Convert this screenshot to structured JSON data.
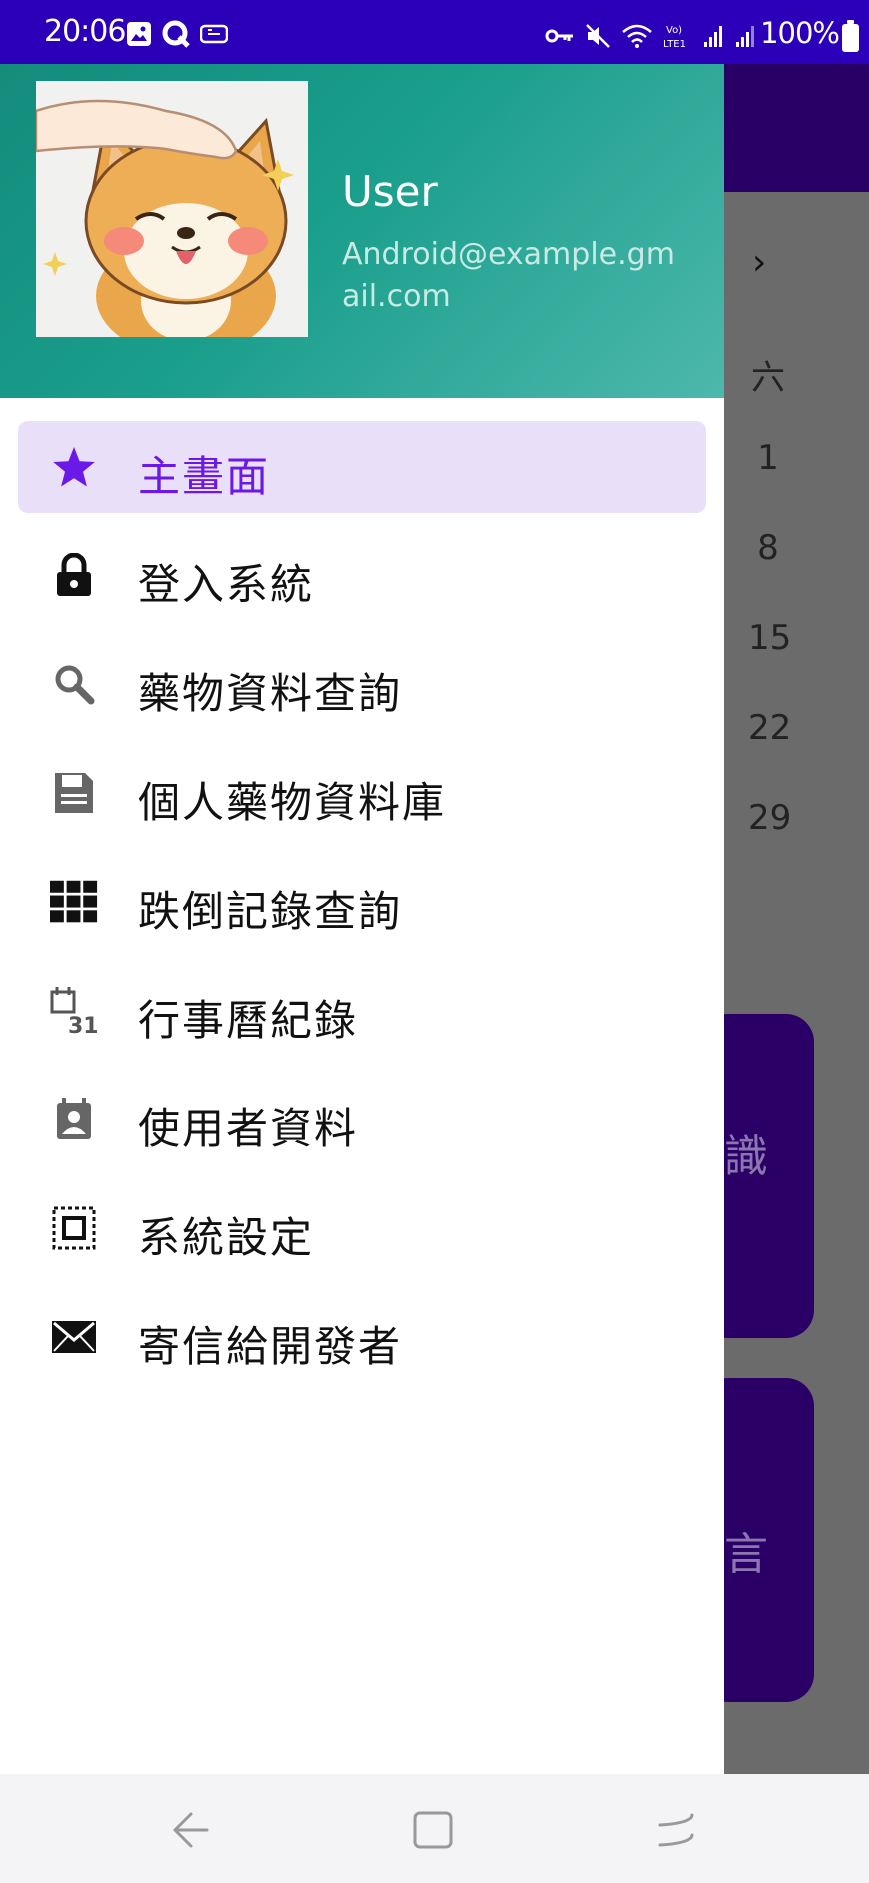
{
  "status_bar": {
    "time": "20:06",
    "battery": "100%",
    "left_icons": [
      "image-icon",
      "q-app-icon",
      "ticket-icon"
    ],
    "right_icons": [
      "key-icon",
      "mute-icon",
      "wifi-icon",
      "volte-icon",
      "signal-icon",
      "signal-icon-2"
    ]
  },
  "drawer": {
    "user_name": "User",
    "user_email": "Android@example.gmail.com",
    "menu": [
      {
        "label": "主畫面",
        "icon": "star-icon",
        "active": true
      },
      {
        "label": "登入系統",
        "icon": "lock-icon",
        "active": false
      },
      {
        "label": "藥物資料查詢",
        "icon": "search-icon",
        "active": false
      },
      {
        "label": "個人藥物資料庫",
        "icon": "save-icon",
        "active": false
      },
      {
        "label": "跌倒記錄查詢",
        "icon": "grid-icon",
        "active": false
      },
      {
        "label": "行事曆紀錄",
        "icon": "calendar-31-icon",
        "active": false
      },
      {
        "label": "使用者資料",
        "icon": "contact-icon",
        "active": false
      },
      {
        "label": "系統設定",
        "icon": "settings-frame-icon",
        "active": false
      },
      {
        "label": "寄信給開發者",
        "icon": "mail-icon",
        "active": false
      }
    ],
    "colors": {
      "accent": "#6a19e6",
      "active_bg": "#eadff8",
      "header_start": "#138c7c",
      "header_end": "#4db8ac"
    }
  },
  "background_app": {
    "chevron": "›",
    "weekday": "六",
    "dates": [
      "1",
      "8",
      "15",
      "22",
      "29"
    ],
    "card_1_fragment": "識",
    "card_2_fragment": "言"
  },
  "nav_bar": {
    "buttons": [
      "back-icon",
      "home-icon",
      "recents-icon"
    ]
  }
}
